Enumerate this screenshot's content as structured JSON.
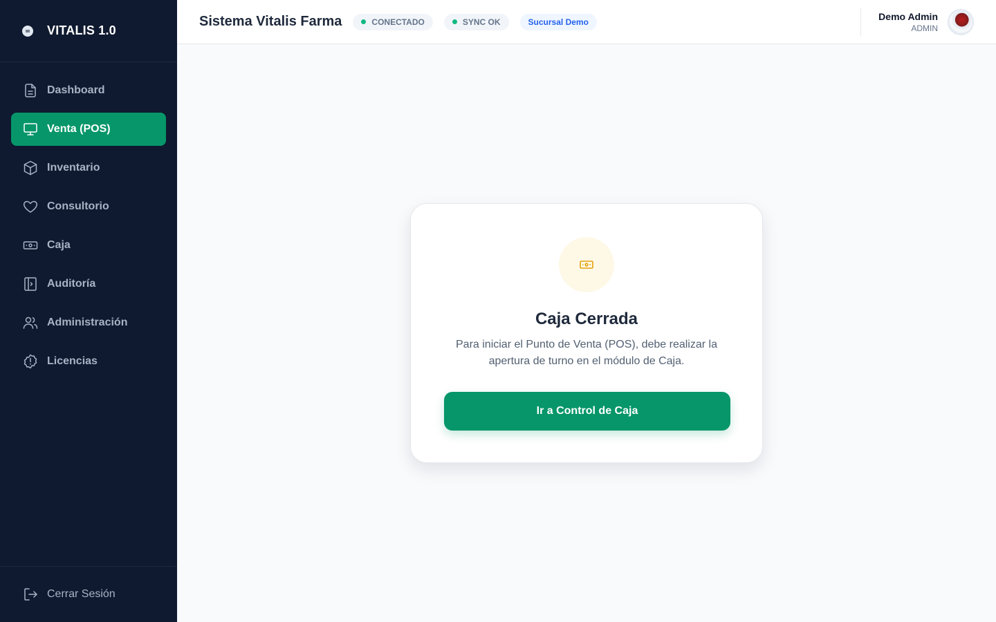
{
  "brand": {
    "name": "VITALIS 1.0"
  },
  "sidebar": {
    "items": [
      {
        "label": "Dashboard",
        "icon": "document-icon"
      },
      {
        "label": "Venta (POS)",
        "icon": "monitor-icon",
        "active": true
      },
      {
        "label": "Inventario",
        "icon": "cube-icon"
      },
      {
        "label": "Consultorio",
        "icon": "heart-icon"
      },
      {
        "label": "Caja",
        "icon": "cash-icon"
      },
      {
        "label": "Auditoría",
        "icon": "panel-icon"
      },
      {
        "label": "Administración",
        "icon": "users-icon"
      },
      {
        "label": "Licencias",
        "icon": "alert-icon"
      }
    ],
    "logout_label": "Cerrar Sesión"
  },
  "header": {
    "title": "Sistema Vitalis Farma",
    "badges": {
      "connected": "CONECTADO",
      "sync": "SYNC OK",
      "branch": "Sucursal Demo"
    },
    "user": {
      "name": "Demo Admin",
      "role": "ADMIN"
    }
  },
  "card": {
    "title": "Caja Cerrada",
    "description": "Para iniciar el Punto de Venta (POS), debe realizar la apertura de turno en el módulo de Caja.",
    "button_label": "Ir a Control de Caja",
    "icon": "cash-icon"
  },
  "colors": {
    "sidebar_bg": "#0f1a30",
    "accent": "#069669",
    "status_dot": "#10b981",
    "branch_badge": "#2563eb",
    "warning_icon": "#e3a008"
  }
}
